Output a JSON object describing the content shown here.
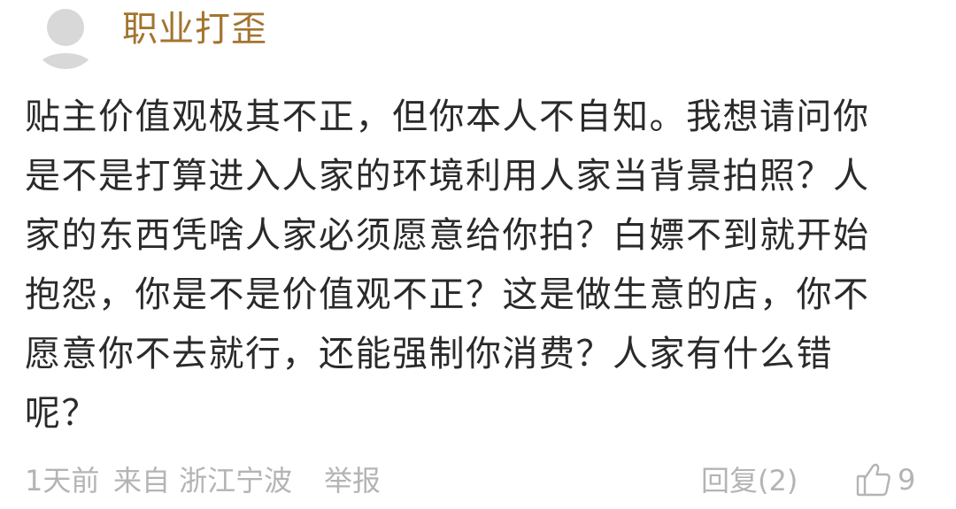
{
  "comment": {
    "username": "职业打歪",
    "body": "贴主价值观极其不正，但你本人不自知。我想请问你\n是不是打算进入人家的环境利用人家当背景拍照？人\n家的东西凭啥人家必须愿意给你拍？白嫖不到就开始\n抱怨，你是不是价值观不正？这是做生意的店，你不\n愿意你不去就行，还能强制你消费？人家有什么错\n呢？",
    "time": "1天前",
    "source": "来自 浙江宁波",
    "report_label": "举报",
    "reply_label": "回复(2)",
    "like_count": "9"
  },
  "icons": {
    "avatar": "default-avatar-icon",
    "like": "thumbs-up-icon"
  },
  "colors": {
    "username": "#a37430",
    "body_text": "#2a2a2a",
    "meta_text": "#b4b4b4",
    "avatar_fill": "#d8d8d8"
  }
}
